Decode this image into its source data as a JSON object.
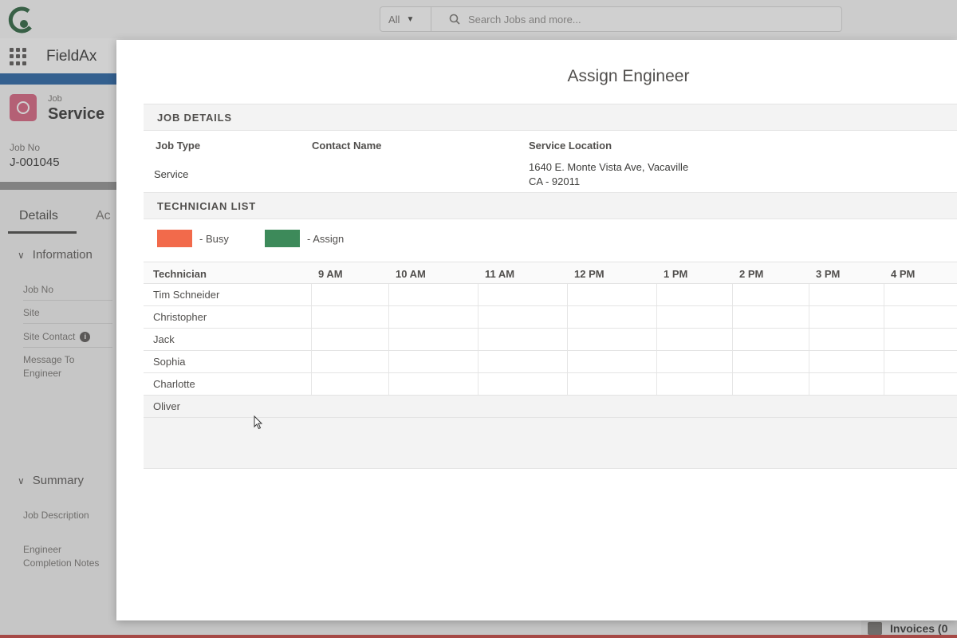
{
  "app": {
    "name": "FieldAx",
    "search": {
      "scope": "All",
      "placeholder": "Search Jobs and more..."
    }
  },
  "record": {
    "type": "Job",
    "title": "Service",
    "job_no_label": "Job No",
    "job_no_value": "J-001045"
  },
  "tabs": [
    {
      "label": "Details"
    },
    {
      "label": "Ac"
    }
  ],
  "sections": {
    "information": {
      "title": "Information",
      "fields": [
        "Job No",
        "Site",
        "Site Contact",
        "Message To\nEngineer"
      ]
    },
    "summary": {
      "title": "Summary",
      "fields": [
        "Job Description",
        "Engineer\nCompletion Notes"
      ]
    }
  },
  "footer": {
    "invoices_label": "Invoices (0"
  },
  "modal": {
    "title": "Assign Engineer",
    "job_details": {
      "header": "JOB DETAILS",
      "job_type_label": "Job Type",
      "job_type_value": "Service",
      "contact_name_label": "Contact Name",
      "contact_name_value": "",
      "service_location_label": "Service Location",
      "service_location_line1": "1640 E. Monte Vista Ave, Vacaville",
      "service_location_line2": "CA - 92011"
    },
    "technician_list": {
      "header": "TECHNICIAN LIST",
      "legend": [
        {
          "label": "-   Busy",
          "color": "#f26a4b"
        },
        {
          "label": "- Assign",
          "color": "#3d8a5a"
        }
      ],
      "columns": [
        "Technician",
        "9 AM",
        "10 AM",
        "11 AM",
        "12 PM",
        "1 PM",
        "2 PM",
        "3 PM",
        "4 PM"
      ],
      "technicians": [
        "Tim Schneider",
        "Christopher",
        "Jack",
        "Sophia",
        "Charlotte",
        "Oliver"
      ]
    }
  }
}
